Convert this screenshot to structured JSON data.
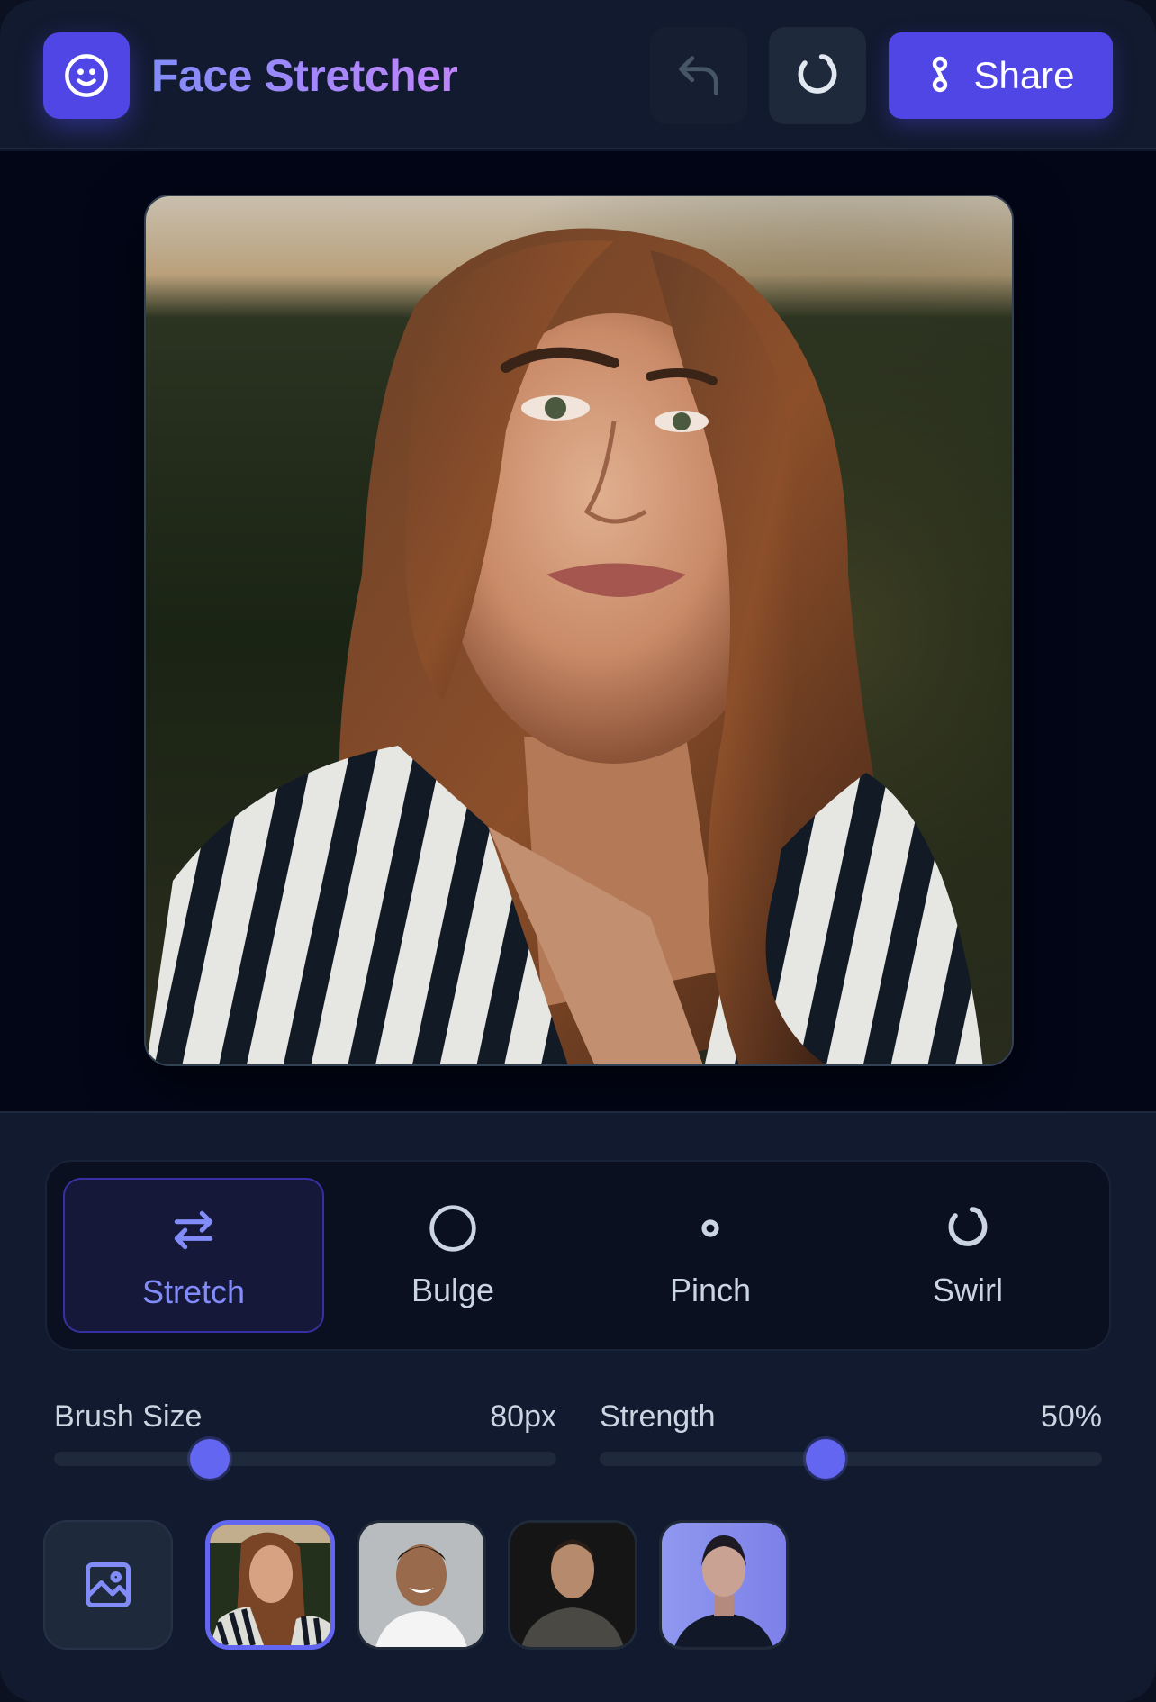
{
  "header": {
    "title": "Face Stretcher",
    "share_label": "Share"
  },
  "tools": [
    {
      "label": "Stretch",
      "icon": "arrows-left-right-icon",
      "active": true
    },
    {
      "label": "Bulge",
      "icon": "circle-icon",
      "active": false
    },
    {
      "label": "Pinch",
      "icon": "small-dot-icon",
      "active": false
    },
    {
      "label": "Swirl",
      "icon": "swirl-icon",
      "active": false
    }
  ],
  "sliders": {
    "brush_size": {
      "label": "Brush Size",
      "value_text": "80px",
      "fraction": 0.31
    },
    "strength": {
      "label": "Strength",
      "value_text": "50%",
      "fraction": 0.45
    }
  },
  "gallery": {
    "upload_icon": "image-icon",
    "selected_index": 0,
    "count": 4
  },
  "colors": {
    "accent": "#4f46e5",
    "accent_light": "#818cf8",
    "background": "#0f172a"
  }
}
